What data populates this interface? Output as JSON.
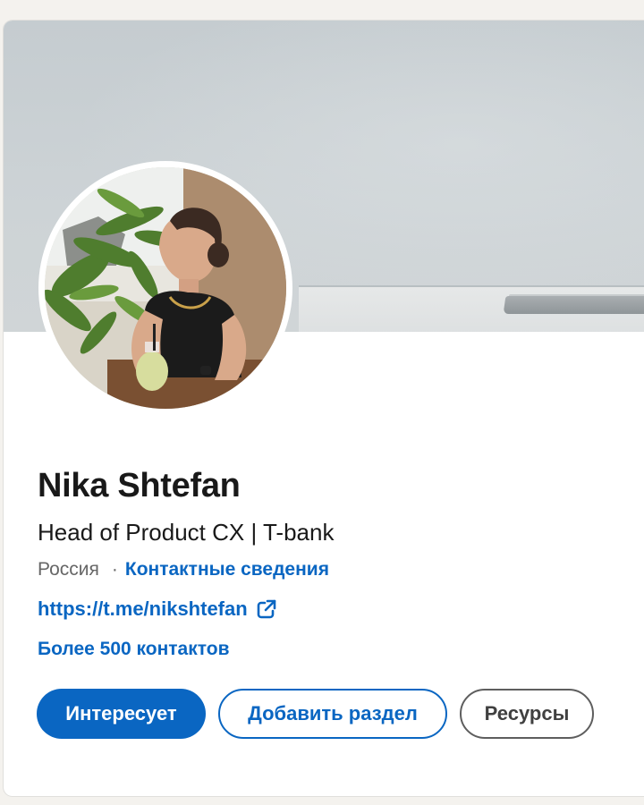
{
  "profile": {
    "name": "Nika Shtefan",
    "headline": "Head of Product CX | T-bank",
    "location": "Россия",
    "separator": "·",
    "contact_info_label": "Контактные сведения",
    "website": "https://t.me/nikshtefan",
    "website_icon": "external-link-icon",
    "connections": "Более 500 контактов"
  },
  "actions": {
    "open_to_label": "Интересует",
    "add_section_label": "Добавить раздел",
    "resources_label": "Ресурсы"
  },
  "colors": {
    "accent": "#0a66c2",
    "text_primary": "#191919",
    "text_secondary": "#666666",
    "page_background": "#f4f2ee"
  }
}
